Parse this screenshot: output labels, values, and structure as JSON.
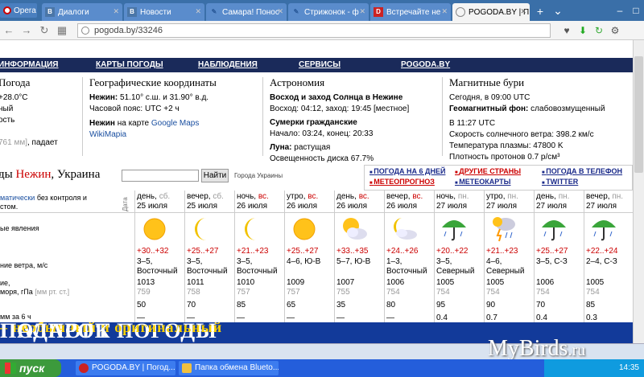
{
  "browser": {
    "app_label": "Opera",
    "tabs": [
      {
        "label": "Диалоги",
        "icon": "vk-icon"
      },
      {
        "label": "Новости",
        "icon": "vk-icon"
      },
      {
        "label": "Самара! Понос",
        "icon": "livejournal-icon"
      },
      {
        "label": "Стрижонок - ф",
        "icon": "livejournal-icon"
      },
      {
        "label": "Встречайте не",
        "icon": "d-icon"
      },
      {
        "label": "POGODA.BY | П",
        "icon": "globe-icon"
      }
    ],
    "url": "pogoda.by/33246"
  },
  "site": {
    "nav": [
      "ИНФОРМАЦИЯ",
      "КАРТЫ ПОГОДЫ",
      "НАБЛЮДЕНИЯ",
      "СЕРВИСЫ",
      "POGODA.BY"
    ],
    "col1": {
      "title": "Погода",
      "temp": "+28.0°C",
      "line2": "ный",
      "line3": "ость",
      "pressure_hint": "761 мм]",
      "falls": ", падает"
    },
    "geo": {
      "title": "Географические координаты",
      "coords_label": "Нежин:",
      "coords": " 51.10° с.ш. и 31.90° в.д.",
      "tz": "Часовой пояс: UTC +2 ч",
      "map_label": "Нежин",
      "map_text": " на карте ",
      "map_link": "Google Maps",
      "wiki": "WikiMapia"
    },
    "astro": {
      "title": "Астрономия",
      "sun_title": "Восход и заход Солнца в Нежине",
      "sun": "Восход: 04:12,  заход: 19:45 [местное]",
      "twilight_title": "Сумерки гражданские",
      "twilight": "Начало: 03:24,  конец: 20:33",
      "moon_label": "Луна:",
      "moon": " растущая",
      "illum": "Освещенность диска 67.7%"
    },
    "mag": {
      "title": "Магнитные бури",
      "today": "Сегодня, в 09:00 UTC",
      "geo_label": "Геомагнитный фон:",
      "geo_val": " слабовозмущенный",
      "time": "В 11:27 UTC",
      "wind": "Скорость солнечного ветра: 398.2 км/с",
      "plasma": "Температура плазмы: 47800 K",
      "density": "Плотность протонов 0.7 р/см³"
    },
    "city_prefix": "ды ",
    "city_name": "Нежин",
    "city_suffix": ", Украина",
    "search_btn": "Найти",
    "cities_link": "Города Украины",
    "quick": {
      "q1": "ПОГОДА НА 6 ДНЕЙ",
      "q2": "МЕТЕОПРОГНОЗ",
      "q3": "ДРУГИЕ СТРАНЫ",
      "q4": "МЕТЕОКАРТЫ",
      "q5": "ПОГОДА В ТЕЛЕФОН",
      "q6": "TWITTER"
    },
    "date_vertical": "Дата",
    "row_labels": {
      "auto_a": "матически",
      "auto_b": " без контроля и",
      "auto_c": "стом.",
      "phen": "ые явления",
      "wind": "ние ветра, м/с",
      "press1": "ие,",
      "press2": "моря, гПа",
      "press_units": "[мм рт. ст.]",
      "precip": "мм за 6 ч"
    },
    "banner_main": "ПАСПОРТ ПОГОДЫ",
    "banner_sub": " – необычный и оригинальный ",
    "banner_end": "ПОДАРОК"
  },
  "forecast": [
    {
      "period": "день,",
      "dow": "сб.",
      "date": "25 июля",
      "weather": "sun",
      "temp": "+30..+32",
      "wind": "3–5,",
      "wind_dir": "Восточный",
      "p_hpa": "1013",
      "p_mm": "759",
      "humidity": "50",
      "precip": "—"
    },
    {
      "period": "вечер,",
      "dow": "сб.",
      "date": "25 июля",
      "weather": "moon",
      "temp": "+25..+27",
      "wind": "3–5,",
      "wind_dir": "Восточный",
      "p_hpa": "1011",
      "p_mm": "758",
      "humidity": "70",
      "precip": "—"
    },
    {
      "period": "ночь,",
      "dow": "вс.",
      "date": "26 июля",
      "weather": "moon",
      "temp": "+21..+23",
      "wind": "3–5,",
      "wind_dir": "Восточный",
      "p_hpa": "1010",
      "p_mm": "757",
      "humidity": "85",
      "precip": "—"
    },
    {
      "period": "утро,",
      "dow": "вс.",
      "date": "26 июля",
      "weather": "sun",
      "temp": "+25..+27",
      "wind": "4–6, Ю-В",
      "wind_dir": "",
      "p_hpa": "1009",
      "p_mm": "757",
      "humidity": "65",
      "precip": "—"
    },
    {
      "period": "день,",
      "dow": "вс.",
      "date": "26 июля",
      "weather": "sun-cloud",
      "temp": "+33..+35",
      "wind": "5–7, Ю-В",
      "wind_dir": "",
      "p_hpa": "1007",
      "p_mm": "755",
      "humidity": "35",
      "precip": "—"
    },
    {
      "period": "вечер,",
      "dow": "вс.",
      "date": "26 июля",
      "weather": "moon-cloud",
      "temp": "+24..+26",
      "wind": "1–3,",
      "wind_dir": "Восточный",
      "p_hpa": "1006",
      "p_mm": "754",
      "humidity": "80",
      "precip": "—"
    },
    {
      "period": "ночь,",
      "dow": "пн.",
      "date": "27 июля",
      "weather": "rain",
      "temp": "+20..+22",
      "wind": "3–5,",
      "wind_dir": "Северный",
      "p_hpa": "1005",
      "p_mm": "754",
      "humidity": "95",
      "precip": "0.4"
    },
    {
      "period": "утро,",
      "dow": "пн.",
      "date": "27 июля",
      "weather": "storm",
      "temp": "+21..+23",
      "wind": "4–6,",
      "wind_dir": "Северный",
      "p_hpa": "1005",
      "p_mm": "754",
      "humidity": "90",
      "precip": "0.7"
    },
    {
      "period": "день,",
      "dow": "пн.",
      "date": "27 июля",
      "weather": "rain",
      "temp": "+25..+27",
      "wind": "3–5, С-З",
      "wind_dir": "",
      "p_hpa": "1006",
      "p_mm": "754",
      "humidity": "70",
      "precip": "0.4"
    },
    {
      "period": "вечер,",
      "dow": "пн.",
      "date": "27 июля",
      "weather": "rain",
      "temp": "+22..+24",
      "wind": "2–4, С-З",
      "wind_dir": "",
      "p_hpa": "1005",
      "p_mm": "754",
      "humidity": "85",
      "precip": "0.3"
    }
  ],
  "taskbar": {
    "start": "пуск",
    "task1": "POGODA.BY | Погод...",
    "task2": "Папка обмена Blueto...",
    "clock": "14:35"
  },
  "watermark": {
    "name": "MyBirds",
    "tld": ".ru"
  }
}
